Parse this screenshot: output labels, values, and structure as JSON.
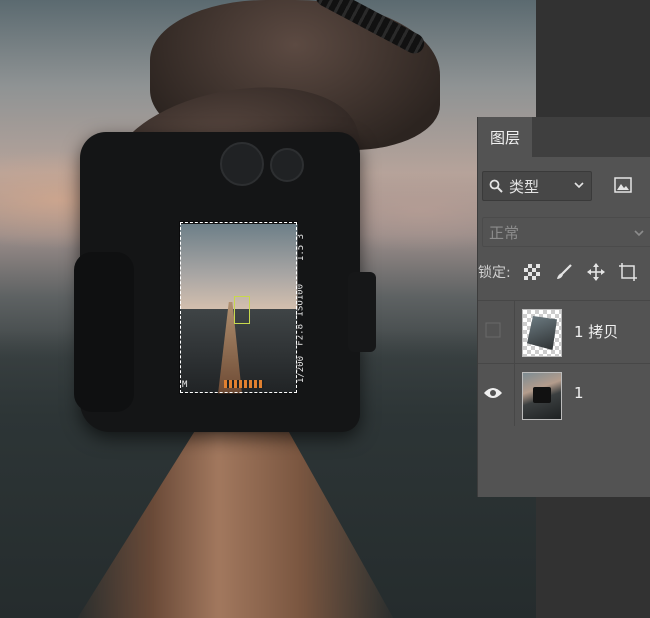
{
  "layers_panel": {
    "tab_label": "图层",
    "filter": {
      "label": "类型",
      "icon": "search-icon"
    },
    "blend_mode": "正常",
    "lock": {
      "label": "锁定:",
      "icons": [
        "transparency-lock-icon",
        "brush-lock-icon",
        "move-lock-icon",
        "artboard-lock-icon"
      ]
    },
    "layers": [
      {
        "name": "1 拷贝",
        "visible": false,
        "thumbnail": "transparent-cutout"
      },
      {
        "name": "1",
        "visible": true,
        "thumbnail": "photo"
      }
    ]
  },
  "camera_hud": {
    "top_right": "1.5 3",
    "iso_label": "ISO100",
    "aperture": "F2.8",
    "shutter": "1/200",
    "mode": "M"
  },
  "colors": {
    "panel_bg": "#535353",
    "panel_tab_bar": "#3f3f3f",
    "workspace_dark": "#323232",
    "meter_orange": "#e08030"
  }
}
